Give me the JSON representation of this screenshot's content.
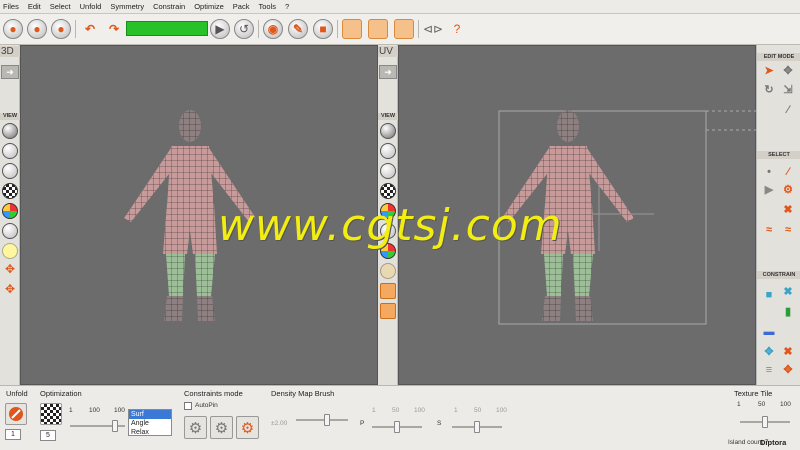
{
  "menu": [
    "Files",
    "Edit",
    "Select",
    "Unfold",
    "Symmetry",
    "Constrain",
    "Optimize",
    "Pack",
    "Tools",
    "?"
  ],
  "viewports": {
    "left_label": "3D",
    "right_label": "UV"
  },
  "left_sidebar": {
    "view_header": "VIEW"
  },
  "mid_sidebar": {
    "view_header": "VIEW"
  },
  "right_panel": {
    "edit_mode": "EDIT MODE",
    "select": "SELECT",
    "constrain": "CONSTRAIN"
  },
  "bottom": {
    "unfold_label": "Unfold",
    "unfold_spin": "1",
    "optimization_label": "Optimization",
    "opt_ticks": [
      "1",
      "100",
      "100"
    ],
    "opt_spin": "5",
    "opt_methods": [
      "Surf",
      "Angle",
      "Relax"
    ],
    "opt_selected": "Surf",
    "opt_slider_fraction": 0.82,
    "constraints_label": "Constraints mode",
    "autopin_label": "AutoPin",
    "density_label": "Density Map Brush",
    "density_value": "±2.00",
    "density_ticks": [
      "1",
      "50",
      "100",
      "1",
      "50",
      "100"
    ],
    "p_label": "P",
    "s_label": "S",
    "texture_tile_label": "Texture Tile",
    "tile_ticks": [
      "1",
      "50",
      "100"
    ],
    "island_count": "Island count 7",
    "brand": "Diptora"
  },
  "watermark": "www.cgtsj.com",
  "colors": {
    "viewport_bg": "#6c6c6c",
    "progress_green": "#27c227",
    "accent_orange": "#e0561b",
    "mesh_skin": "#c99a9a",
    "mesh_legs": "#9cbf98"
  }
}
